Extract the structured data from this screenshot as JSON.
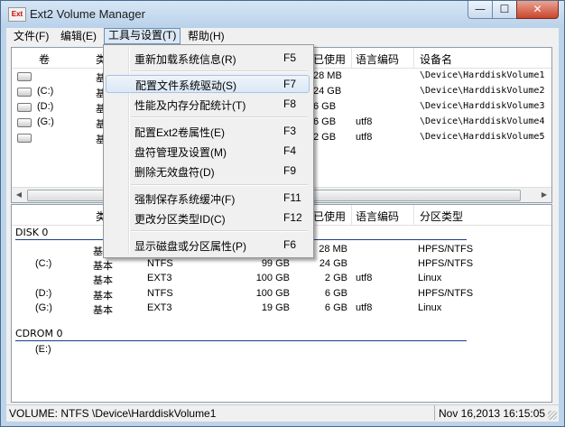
{
  "window": {
    "title": "Ext2 Volume Manager",
    "icon_text": "Ext",
    "min": "—",
    "max": "☐",
    "close": "✕"
  },
  "menubar": [
    {
      "label": "文件(F)"
    },
    {
      "label": "编辑(E)"
    },
    {
      "label": "工具与设置(T)"
    },
    {
      "label": "帮助(H)"
    }
  ],
  "top_table": {
    "headers": [
      "卷",
      "类",
      "已使用",
      "语言编码",
      "设备名"
    ],
    "rows": [
      {
        "vol": "",
        "type": "基",
        "used": "28 MB",
        "enc": "",
        "dev": "\\Device\\HarddiskVolume1"
      },
      {
        "vol": "(C:)",
        "type": "基",
        "used": "24 GB",
        "enc": "",
        "dev": "\\Device\\HarddiskVolume2"
      },
      {
        "vol": "(D:)",
        "type": "基",
        "used": "6 GB",
        "enc": "",
        "dev": "\\Device\\HarddiskVolume3"
      },
      {
        "vol": "(G:)",
        "type": "基",
        "used": "6 GB",
        "enc": "utf8",
        "dev": "\\Device\\HarddiskVolume4"
      },
      {
        "vol": "",
        "type": "基",
        "used": "2 GB",
        "enc": "utf8",
        "dev": "\\Device\\HarddiskVolume5"
      }
    ]
  },
  "bottom_table": {
    "headers": [
      "类",
      "已使用",
      "语言编码",
      "分区类型"
    ],
    "disk0": {
      "title": "DISK 0",
      "rows": [
        {
          "vol": "",
          "type": "基本",
          "fs": "",
          "size": "",
          "used": "28 MB",
          "enc": "",
          "ptype": "HPFS/NTFS"
        },
        {
          "vol": "(C:)",
          "type": "基本",
          "fs": "NTFS",
          "size": "99 GB",
          "used": "24 GB",
          "enc": "",
          "ptype": "HPFS/NTFS"
        },
        {
          "vol": "",
          "type": "基本",
          "fs": "EXT3",
          "size": "100 GB",
          "used": "2 GB",
          "enc": "utf8",
          "ptype": "Linux"
        },
        {
          "vol": "(D:)",
          "type": "基本",
          "fs": "NTFS",
          "size": "100 GB",
          "used": "6 GB",
          "enc": "",
          "ptype": "HPFS/NTFS"
        },
        {
          "vol": "(G:)",
          "type": "基本",
          "fs": "EXT3",
          "size": "19 GB",
          "used": "6 GB",
          "enc": "utf8",
          "ptype": "Linux"
        }
      ]
    },
    "cdrom0": {
      "title": "CDROM 0",
      "rows": [
        {
          "vol": "(E:)"
        }
      ]
    }
  },
  "dropdown": {
    "items": [
      {
        "label": "重新加载系统信息(R)",
        "key": "F5"
      },
      {
        "label": "配置文件系统驱动(S)",
        "key": "F7"
      },
      {
        "label": "性能及内存分配统计(T)",
        "key": "F8"
      },
      {
        "label": "配置Ext2卷属性(E)",
        "key": "F3"
      },
      {
        "label": "盘符管理及设置(M)",
        "key": "F4"
      },
      {
        "label": "删除无效盘符(D)",
        "key": "F9"
      },
      {
        "label": "强制保存系统缓冲(F)",
        "key": "F11"
      },
      {
        "label": "更改分区类型ID(C)",
        "key": "F12"
      },
      {
        "label": "显示磁盘或分区属性(P)",
        "key": "F6"
      }
    ]
  },
  "statusbar": {
    "left": "VOLUME:  NTFS \\Device\\HarddiskVolume1",
    "right": "Nov 16,2013 16:15:05"
  }
}
